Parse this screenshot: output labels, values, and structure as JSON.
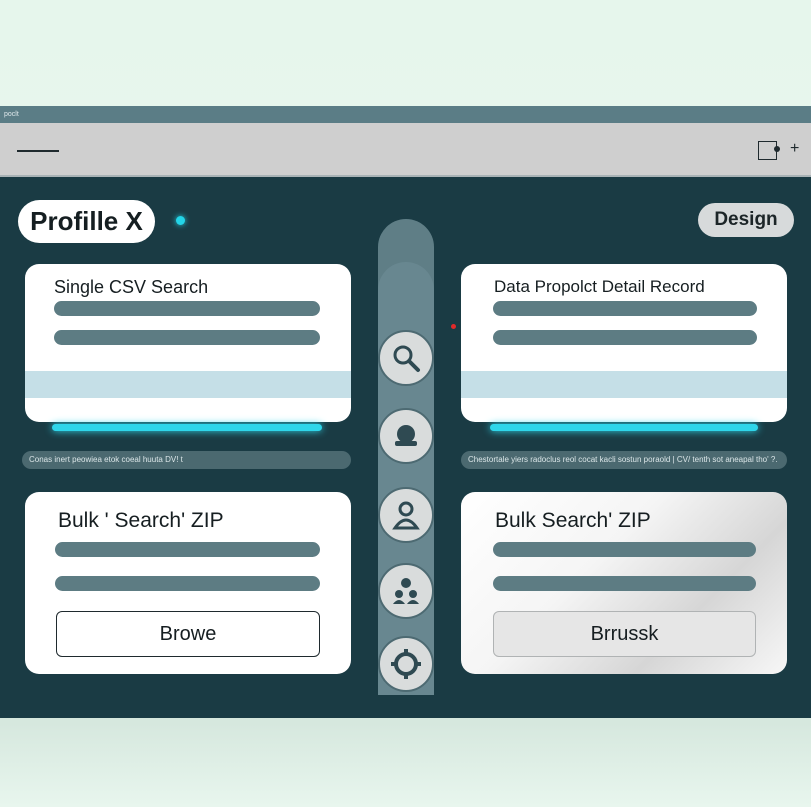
{
  "window": {
    "title": "poclt"
  },
  "header": {
    "profile_label": "Profille X",
    "design_label": "Design"
  },
  "cards": {
    "top_left": {
      "title": "Single CSV Search"
    },
    "top_right": {
      "title": "Data Propolct Detail Record"
    },
    "bottom_left": {
      "title": "Bulk ' Search' ZIP",
      "button_label": "Browe"
    },
    "bottom_right": {
      "title": "Bulk Search' ZIP",
      "button_label": "Brrussk"
    }
  },
  "captions": {
    "left": "Conas inert peowiea etok coeal huuta  DV! t",
    "right": "Chestortale yiers radoclus reol cocat kacli sostun poraold | CV/  tenth sot aneapal tho' ?."
  },
  "rail_icons": [
    "search-icon",
    "cloud-icon",
    "user-icon",
    "users-icon",
    "settings-icon"
  ],
  "colors": {
    "background": "#1a3b44",
    "accent": "#2fd6ea",
    "rail": "#5f7e86",
    "bar": "#5d7c83",
    "stripe": "#c5dfe7"
  }
}
